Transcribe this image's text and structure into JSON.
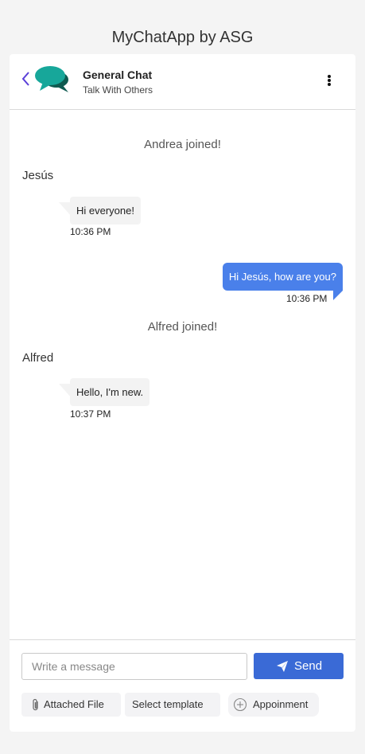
{
  "app": {
    "title": "MyChatApp by ASG"
  },
  "header": {
    "chat_name": "General Chat",
    "chat_subtitle": "Talk With Others",
    "back_icon": "chevron-left-icon",
    "logo_icon": "chat-bubbles-icon",
    "menu_icon": "kebab-menu-icon"
  },
  "messages": {
    "system_1": "Andrea joined!",
    "sender_1": "Jesús",
    "msg_1_text": "Hi everyone!",
    "msg_1_time": "10:36 PM",
    "msg_2_text": "Hi Jesús, how are you?",
    "msg_2_time": "10:36 PM",
    "system_2": "Alfred joined!",
    "sender_2": "Alfred",
    "msg_3_text": "Hello, I'm new.",
    "msg_3_time": "10:37 PM"
  },
  "composer": {
    "placeholder": "Write a message",
    "value": "",
    "send_label": "Send",
    "attach_label": "Attached File",
    "template_label": "Select template",
    "appointment_label": "Appoinment"
  },
  "colors": {
    "accent": "#3a6ad6",
    "outgoing_bubble": "#4a80ea",
    "incoming_bubble": "#f3f3f3",
    "logo_teal": "#17a79a",
    "logo_dark": "#0f5a50",
    "back_arrow": "#5a3fd8"
  }
}
